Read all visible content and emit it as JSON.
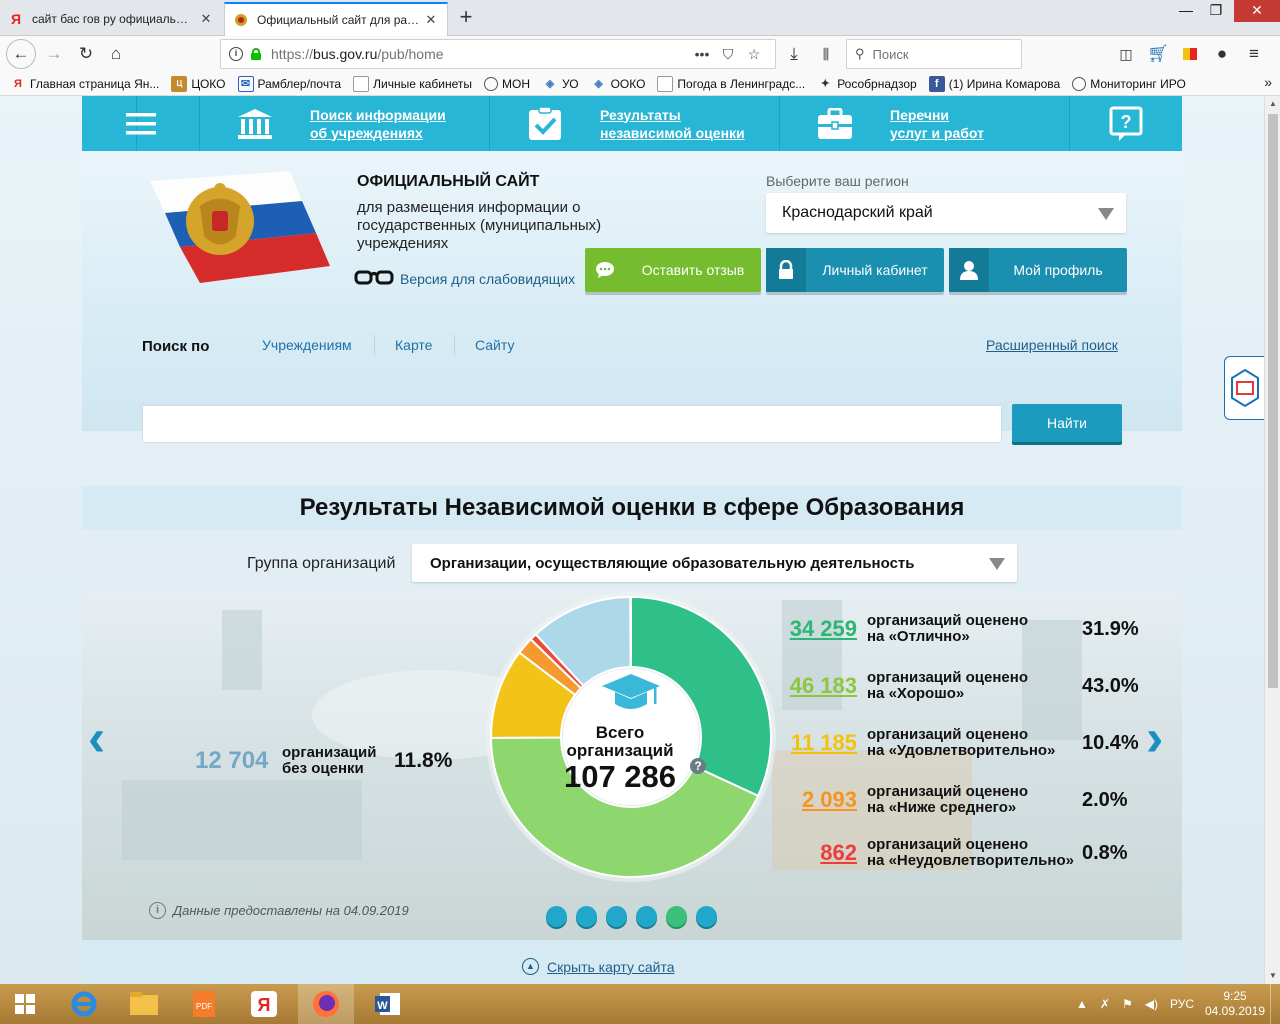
{
  "browser": {
    "tabs": [
      {
        "title": "сайт бас гов ру официальный",
        "favicon": "yandex-icon"
      },
      {
        "title": "Официальный сайт для разме",
        "favicon": "emblem-icon"
      }
    ],
    "url_prefix": "https://",
    "url_host": "bus.gov.ru",
    "url_path": "/pub/home",
    "search_placeholder": "Поиск",
    "bookmarks": [
      "Главная страница Ян...",
      "ЦОКО",
      "Рамблер/почта",
      "Личные кабинеты",
      "МОН",
      "УО",
      "ОOКО",
      "Погода в Ленинградс...",
      "Рособрнадзор",
      "(1) Ирина Комарова",
      "Мониторинг ИРО"
    ]
  },
  "site": {
    "topnav": [
      {
        "label": "Поиск информации\nоб учреждениях",
        "icon": "building-icon"
      },
      {
        "label": "Результаты\nнезависимой оценки",
        "icon": "checkbox-icon"
      },
      {
        "label": "Перечни\nуслуг и работ",
        "icon": "briefcase-icon"
      }
    ],
    "header": {
      "title": "ОФИЦИАЛЬНЫЙ САЙТ",
      "subtitle": "для размещения информации о государственных (муниципальных) учреждениях",
      "low_vision": "Версия для слабовидящих",
      "region_label": "Выберите ваш регион",
      "region_value": "Краснодарский край",
      "btn_feedback": "Оставить отзыв",
      "btn_cabinet": "Личный кабинет",
      "btn_profile": "Мой профиль"
    },
    "search": {
      "by_label": "Поиск по",
      "tabs": [
        "Учреждениям",
        "Карте",
        "Сайту"
      ],
      "advanced": "Расширенный поиск",
      "button": "Найти",
      "value": ""
    },
    "results": {
      "title": "Результаты Независимой оценки в сфере Образования",
      "group_label": "Группа организаций",
      "group_value": "Организации, осуществляющие образовательную деятельность",
      "total_label": "Всего\nорганизаций",
      "total": "107 286",
      "no_eval": {
        "num": "12 704",
        "label": "организаций\nбез оценки",
        "pct": "11.8%",
        "color": "#74a8c4"
      },
      "ratings": [
        {
          "num": "34 259",
          "label": "организаций оценено\nна «Отлично»",
          "pct": "31.9%",
          "color": "#2bb673"
        },
        {
          "num": "46 183",
          "label": "организаций оценено\nна «Хорошо»",
          "pct": "43.0%",
          "color": "#8dc63f"
        },
        {
          "num": "11 185",
          "label": "организаций оценено\nна «Удовлетворительно»",
          "pct": "10.4%",
          "color": "#f4c20d"
        },
        {
          "num": "2 093",
          "label": "организаций оценено\nна «Ниже среднего»",
          "pct": "2.0%",
          "color": "#f7941d"
        },
        {
          "num": "862",
          "label": "организаций оценено\nна «Неудовлетворительно»",
          "pct": "0.8%",
          "color": "#ed3d3d"
        }
      ],
      "donut_fractions": [
        0.319,
        0.43,
        0.104,
        0.02,
        0.008,
        0.118
      ],
      "donut_colors": [
        "#2fc08a",
        "#8ed66e",
        "#f2c318",
        "#f59a2e",
        "#ea4a3c",
        "#add8e8"
      ],
      "data_note": "Данные предоставлены на 04.09.2019",
      "slide_count": 6,
      "active_slide": 5
    },
    "sitemap_toggle": "Скрыть карту сайта"
  },
  "taskbar": {
    "lang": "РУС",
    "time": "9:25",
    "date": "04.09.2019"
  }
}
